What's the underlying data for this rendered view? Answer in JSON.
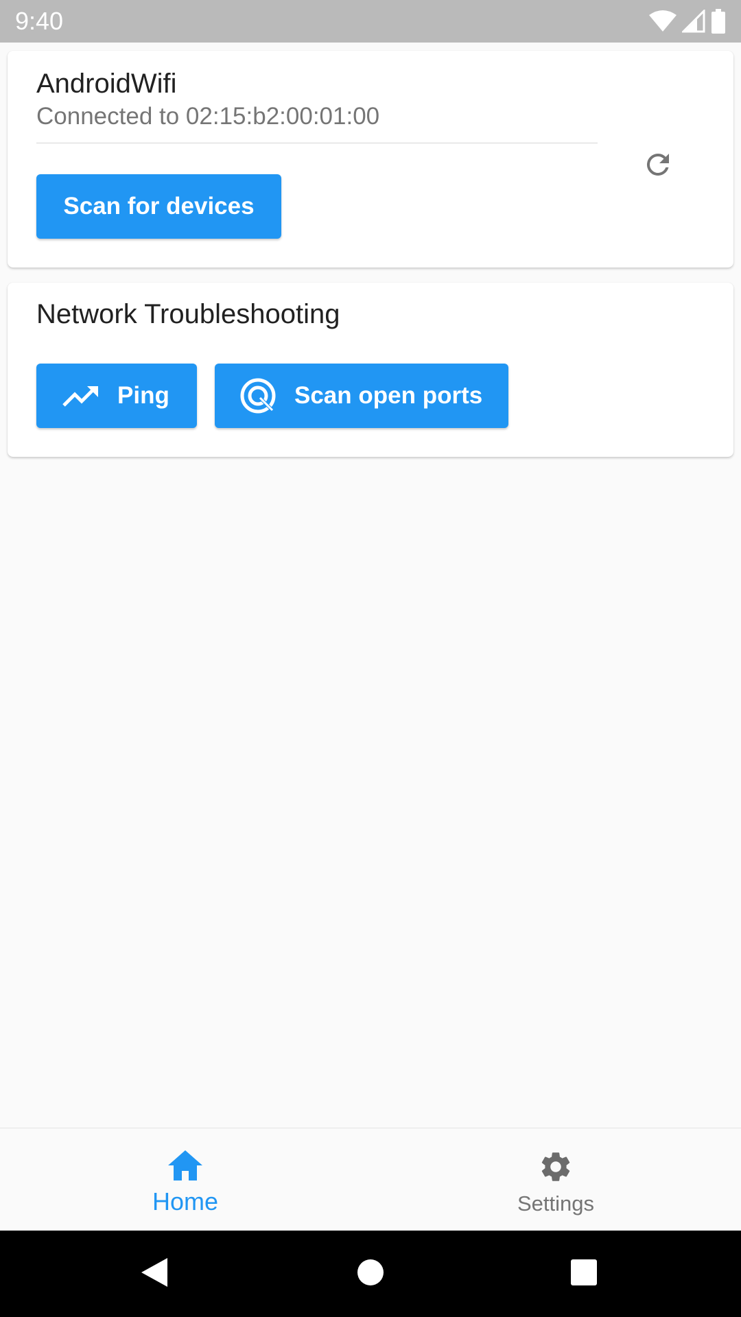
{
  "status_bar": {
    "time": "9:40",
    "icons": [
      "wifi-icon",
      "cell-signal-icon",
      "battery-icon"
    ]
  },
  "wifi_card": {
    "network_name": "AndroidWifi",
    "connection_status": "Connected to 02:15:b2:00:01:00",
    "refresh_icon": "refresh-icon",
    "scan_button_label": "Scan for devices"
  },
  "troubleshooting_card": {
    "title": "Network Troubleshooting",
    "buttons": [
      {
        "label": "Ping",
        "icon": "trending-up-icon"
      },
      {
        "label": "Scan open ports",
        "icon": "radar-target-icon"
      }
    ]
  },
  "bottom_nav": {
    "items": [
      {
        "label": "Home",
        "icon": "home-icon",
        "selected": true
      },
      {
        "label": "Settings",
        "icon": "settings-gear-icon",
        "selected": false
      }
    ]
  },
  "system_nav": {
    "buttons": [
      "back-triangle-icon",
      "home-circle-icon",
      "recents-square-icon"
    ]
  },
  "colors": {
    "primary": "#2196f3",
    "status_bar": "#bababa",
    "background": "#fafafa",
    "text_primary": "#212121",
    "text_secondary": "#757575"
  }
}
